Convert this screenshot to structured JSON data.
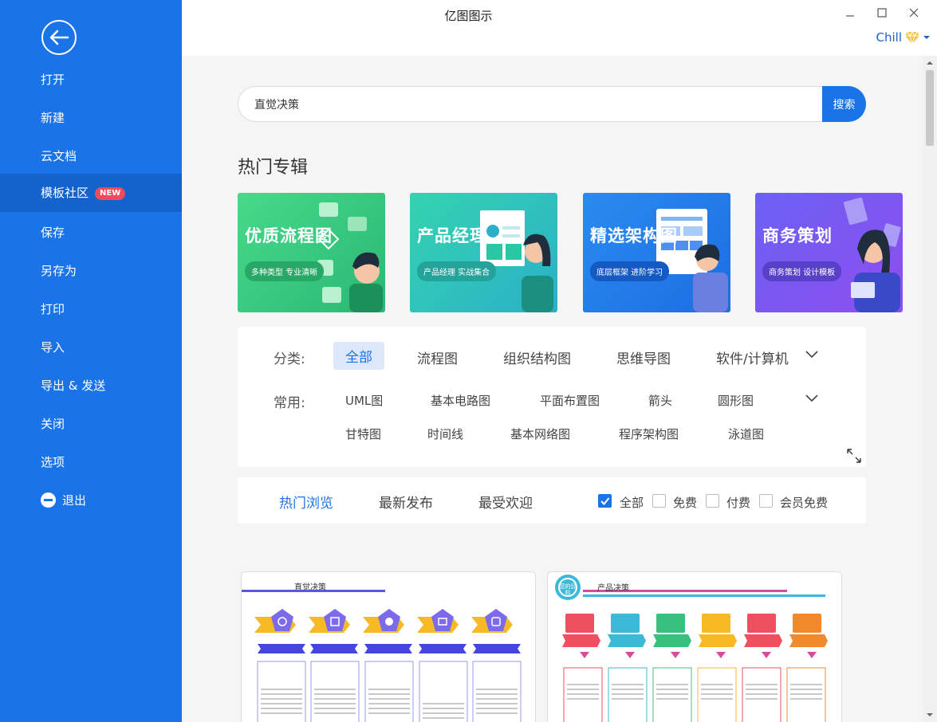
{
  "window": {
    "title": "亿图图示",
    "user": "Chill"
  },
  "sidebar": {
    "items": [
      {
        "label": "打开"
      },
      {
        "label": "新建"
      },
      {
        "label": "云文档"
      },
      {
        "label": "模板社区",
        "badge": "NEW"
      },
      {
        "label": "保存"
      },
      {
        "label": "另存为"
      },
      {
        "label": "打印"
      },
      {
        "label": "导入"
      },
      {
        "label": "导出 & 发送"
      },
      {
        "label": "关闭"
      },
      {
        "label": "选项"
      },
      {
        "label": "退出"
      }
    ]
  },
  "search": {
    "value": "直觉决策",
    "button": "搜索"
  },
  "hot_albums": {
    "title": "热门专辑",
    "banners": [
      {
        "title": "优质流程图",
        "subtitle": "多种类型 专业清晰"
      },
      {
        "title": "产品经理",
        "subtitle": "产品经理 实战集合"
      },
      {
        "title": "精选架构图",
        "subtitle": "底层框架 进阶学习"
      },
      {
        "title": "商务策划",
        "subtitle": "商务策划 设计模板"
      }
    ]
  },
  "filters": {
    "category_label": "分类:",
    "categories": [
      "全部",
      "流程图",
      "组织结构图",
      "思维导图",
      "软件/计算机"
    ],
    "common_label": "常用:",
    "common": [
      "UML图",
      "基本电路图",
      "平面布置图",
      "箭头",
      "圆形图",
      "甘特图",
      "时间线",
      "基本网络图",
      "程序架构图",
      "泳道图"
    ]
  },
  "tabs": {
    "items": [
      "热门浏览",
      "最新发布",
      "最受欢迎"
    ],
    "price_filters": [
      "全部",
      "免费",
      "付费",
      "会员免费"
    ]
  },
  "cards": [
    {
      "title": "直觉决策"
    },
    {
      "title": "产品决策",
      "badge": "您的目标"
    }
  ],
  "colors": {
    "sidebar": "#1a74e8",
    "sidebar_active": "#1463cd",
    "accent": "#1a74e8",
    "badge": "#f04b5a"
  }
}
